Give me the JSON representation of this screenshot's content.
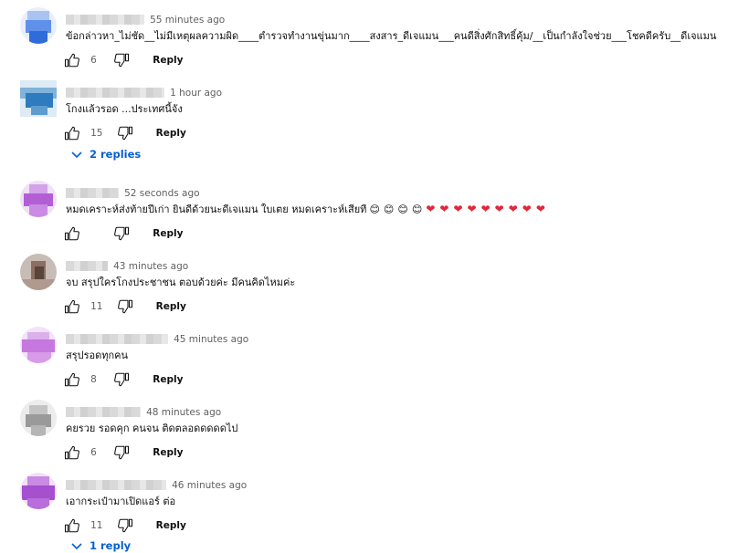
{
  "comments": [
    {
      "time": "55 minutes ago",
      "text": "ข้อกล่าวหา_ไม่ชัด__ไม่มีเหตุผลความผิด____ตำรวจทำงานขุ่นมาก____สงสาร_ดีเจแมน___คนดีสิ่งศักสิทธิ์คุ้ม/__เป็นกำลังใจช่วย___โชคดีครับ__ดีเจแมน",
      "likes": "6",
      "reply_label": "Reply",
      "avatar_color": "#3b78e0"
    },
    {
      "time": "1 hour ago",
      "text": "โกงแล้วรอด ...ประเทศนี้จัง",
      "likes": "15",
      "reply_label": "Reply",
      "avatar_color": "#3a86c6"
    },
    {
      "time": "52 seconds ago",
      "text": "หมดเคราะห์ส่งท้ายปีเก่า ยินดีด้วยนะดีเจแมน ใบเตย หมดเคราะห์เสียที",
      "emojis": [
        "😊",
        "😊",
        "😊",
        "😊"
      ],
      "hearts": [
        "❤",
        "❤",
        "❤",
        "❤",
        "❤",
        "❤",
        "❤",
        "❤",
        "❤"
      ],
      "likes": "",
      "reply_label": "Reply",
      "avatar_color": "#b560d4"
    },
    {
      "time": "43 minutes ago",
      "text": "จบ สรุปใครโกงประชาชน ตอบด้วยค่ะ มีคนคิดไหมค่ะ",
      "likes": "11",
      "reply_label": "Reply",
      "avatar_color": "#8e7468"
    },
    {
      "time": "45 minutes ago",
      "text": "สรุปรอดทุกคน",
      "likes": "8",
      "reply_label": "Reply",
      "avatar_color": "#c474dc"
    },
    {
      "time": "48 minutes ago",
      "text": "คยรวย รอดคุก คนจน ติดตลอดดดดดไป",
      "likes": "6",
      "reply_label": "Reply",
      "avatar_color": "#9a9a9a"
    },
    {
      "time": "46 minutes ago",
      "text": "เอากระเป๋ามาเปิดแอร์ ต่อ",
      "likes": "11",
      "reply_label": "Reply",
      "avatar_color": "#a64fcf"
    }
  ],
  "replies_toggles": [
    "2 replies",
    "1 reply"
  ],
  "colors": {
    "link": "#065fd4",
    "heart": "#e0283a",
    "secondary": "#606060"
  },
  "icons": [
    "like-icon",
    "dislike-icon",
    "chevron-down-icon"
  ]
}
